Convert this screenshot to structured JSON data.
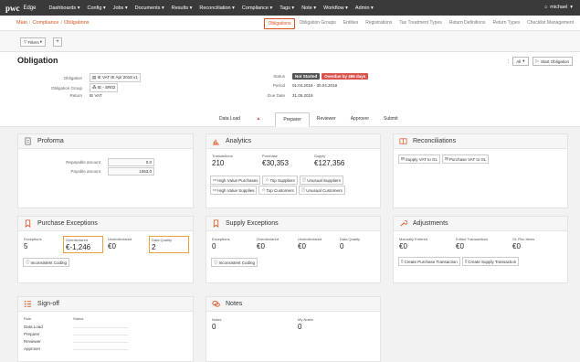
{
  "brand": {
    "logo": "pwc",
    "product": "Edge"
  },
  "nav": [
    "Dashboards",
    "Config",
    "Jobs",
    "Documents",
    "Results",
    "Reconciliation",
    "Compliance",
    "Tags",
    "Note",
    "Workflow",
    "Admin"
  ],
  "user": "michael",
  "breadcrumb": [
    "Main",
    "Compliance",
    "Obligations"
  ],
  "subtabs": [
    "Obligations",
    "Obligation Groups",
    "Entities",
    "Registrations",
    "Tax Treatment Types",
    "Return Definitions",
    "Return Types",
    "Checklist Management"
  ],
  "filters_label": "Filters",
  "page_title": "Obligation",
  "header_actions": {
    "all_label": "All",
    "start_label": "Start Obligation"
  },
  "fields": {
    "obligation_label": "Obligation",
    "obligation_value": "IE VAT IE Apr 2018 v1",
    "group_label": "Obligation Group",
    "group_value": "IE - SR02",
    "return_label": "Return",
    "return_value": "IE VAT",
    "status_label": "Status",
    "status_badge1": "Not Started",
    "status_badge2": "Overdue by 486 days",
    "period_label": "Period",
    "period_value": "01.04.2018 - 30.04.2018",
    "due_label": "Due Date",
    "due_value": "31.05.2018"
  },
  "tabs": [
    "Data Load",
    "Preparer",
    "Reviewer",
    "Approver",
    "Submit"
  ],
  "proforma": {
    "title": "Proforma",
    "repayable_label": "Repayable amount",
    "repayable_value": "0.0",
    "payable_label": "Payable amount",
    "payable_value": "1063.0"
  },
  "analytics": {
    "title": "Analytics",
    "transactions_label": "Transactions",
    "transactions_value": "210",
    "purchase_label": "Purchase",
    "purchase_value": "€30,353",
    "supply_label": "Supply",
    "supply_value": "€127,356",
    "buttons": [
      "High Value Purchases",
      "Top Suppliers",
      "Unusual Suppliers",
      "High Value Supplies",
      "Top Customers",
      "Unusual Customers"
    ]
  },
  "reconciliations": {
    "title": "Reconciliations",
    "buttons": [
      "Supply VAT to GL",
      "Purchase VAT to GL"
    ]
  },
  "purchase_exceptions": {
    "title": "Purchase Exceptions",
    "exceptions_label": "Exceptions",
    "exceptions_value": "5",
    "overdeclared_label": "Overdeclared",
    "overdeclared_value": "€-1,246",
    "underdeclared_label": "Underdeclared",
    "underdeclared_value": "€0",
    "quality_label": "Data Quality",
    "quality_value": "2",
    "button": "Inconsistent Coding"
  },
  "supply_exceptions": {
    "title": "Supply Exceptions",
    "exceptions_label": "Exceptions",
    "exceptions_value": "0",
    "overdeclared_label": "Overdeclared",
    "overdeclared_value": "€0",
    "underdeclared_label": "Underdeclared",
    "underdeclared_value": "€0",
    "quality_label": "Data Quality",
    "quality_value": "0",
    "button": "Inconsistent Coding"
  },
  "adjustments": {
    "title": "Adjustments",
    "manual_label": "Manually Entered",
    "manual_value": "€0",
    "edited_label": "Edited Transactions",
    "edited_value": "€0",
    "gl_label": "GL Rec Items",
    "gl_value": "€0",
    "buttons": [
      "Create Purchase Transaction",
      "Create Supply Transaction"
    ]
  },
  "signoff": {
    "title": "Sign-off",
    "role_header": "Role",
    "status_header": "Status",
    "roles": [
      "Data Load",
      "Preparer",
      "Reviewer",
      "Approver"
    ]
  },
  "notes": {
    "title": "Notes",
    "notes_label": "Notes",
    "notes_value": "0",
    "mynotes_label": "My Notes",
    "mynotes_value": "0"
  },
  "colors": {
    "accent": "#d9531e",
    "topbar": "#3a3a3a",
    "danger": "#d9534f",
    "warn": "#e8a33d"
  }
}
